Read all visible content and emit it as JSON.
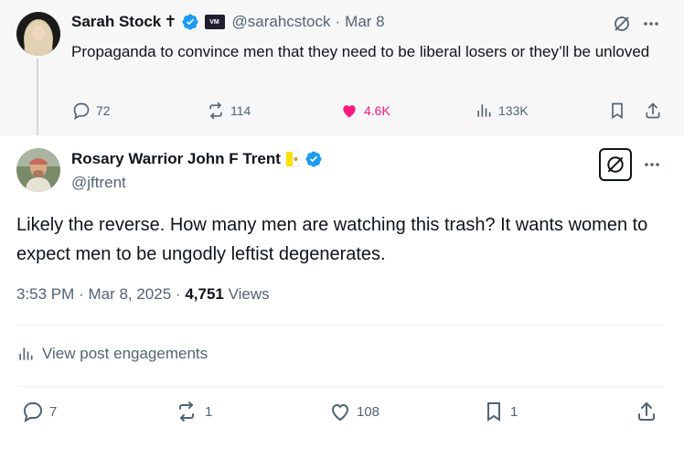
{
  "parent_tweet": {
    "name": "Sarah Stock",
    "name_badge": "✝",
    "handle": "@sarahcstock",
    "separator": "·",
    "date": "Mar 8",
    "text": "Propaganda to convince men that they need to be liberal losers or they’ll be unloved",
    "replies": "72",
    "retweets": "114",
    "likes": "4.6K",
    "views": "133K"
  },
  "main_tweet": {
    "name": "Rosary Warrior John F Trent",
    "handle": "@jftrent",
    "text": "Likely the reverse. How many men are watching this trash? It wants women to expect men to be ungodly leftist degenerates.",
    "time": "3:53 PM",
    "dot1": "·",
    "date": "Mar 8, 2025",
    "dot2": "·",
    "views_count": "4,751",
    "views_label": "Views",
    "engagements_label": "View post engagements",
    "replies": "7",
    "retweets": "1",
    "likes": "108",
    "bookmarks": "1"
  },
  "colors": {
    "accent_blue": "#1d9bf0",
    "like_pink": "#f91880",
    "muted": "#536471"
  },
  "icons": [
    "verified-icon",
    "grok-icon",
    "more-icon",
    "reply-icon",
    "retweet-icon",
    "like-icon",
    "views-icon",
    "bookmark-icon",
    "share-icon",
    "vatican-flag-icon"
  ]
}
